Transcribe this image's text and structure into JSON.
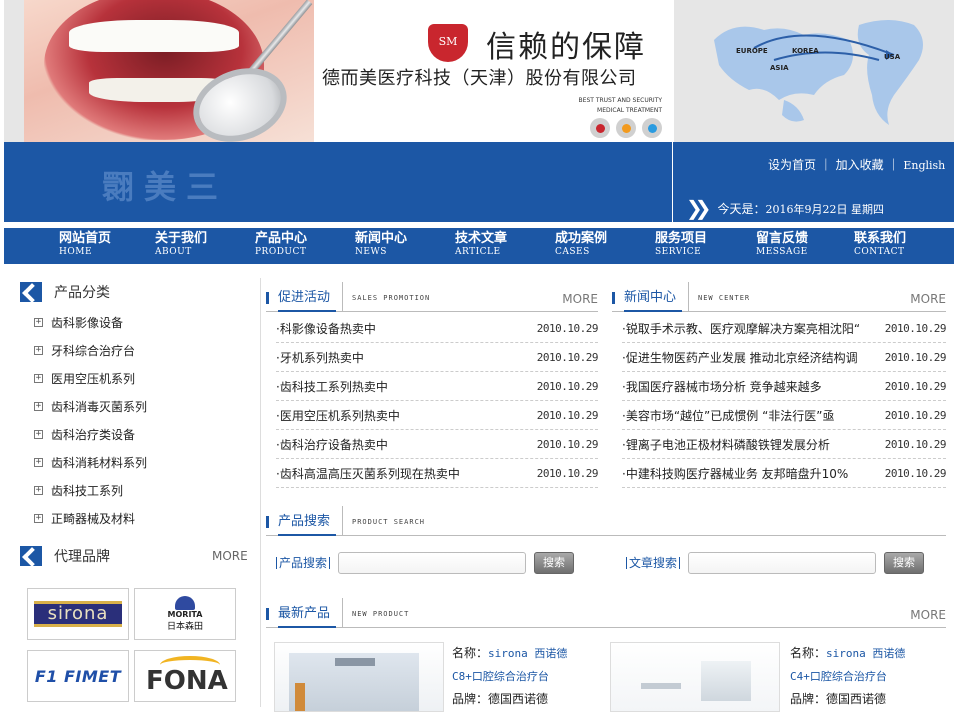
{
  "header": {
    "logo_text": "SM",
    "slogan": "信赖的保障",
    "company": "德而美医疗科技（天津）股份有限公司",
    "tagline_1": "BEST TRUST AND SECURITY",
    "tagline_2": "MEDICAL TREATMENT",
    "map_labels": [
      "EUROPE",
      "KOREA",
      "ASIA",
      "USA"
    ],
    "dot_colors": [
      "#c9262e",
      "#f29a1e",
      "#2a9be0"
    ],
    "band_brand": "翾美三",
    "links": [
      "设为首页",
      "加入收藏",
      "English"
    ],
    "date_prefix": "今天是：",
    "date_text": "2016年9月22日 星期四"
  },
  "nav": [
    {
      "cn": "网站首页",
      "en": "HOME"
    },
    {
      "cn": "关于我们",
      "en": "ABOUT"
    },
    {
      "cn": "产品中心",
      "en": "PRODUCT"
    },
    {
      "cn": "新闻中心",
      "en": "NEWS"
    },
    {
      "cn": "技术文章",
      "en": "ARTICLE"
    },
    {
      "cn": "成功案例",
      "en": "CASES"
    },
    {
      "cn": "服务项目",
      "en": "SERVICE"
    },
    {
      "cn": "留言反馈",
      "en": "MESSAGE"
    },
    {
      "cn": "联系我们",
      "en": "CONTACT"
    }
  ],
  "sidebar": {
    "categories_title": "产品分类",
    "categories": [
      "齿科影像设备",
      "牙科综合治疗台",
      "医用空压机系列",
      "齿科消毒灭菌系列",
      "齿科治疗类设备",
      "齿科消耗材料系列",
      "齿科技工系列",
      "正畸器械及材料"
    ],
    "brands_title": "代理品牌",
    "brands_more": "MORE",
    "brands": [
      "sirona",
      "MORITA",
      "日本森田",
      "F1 FIMET",
      "FONA"
    ]
  },
  "promo": {
    "title": "促进活动",
    "en": "SALES PROMOTION",
    "more": "MORE",
    "items": [
      {
        "title": "·科影像设备热卖中",
        "date": "2010.10.29"
      },
      {
        "title": "·牙机系列热卖中",
        "date": "2010.10.29"
      },
      {
        "title": "·齿科技工系列热卖中",
        "date": "2010.10.29"
      },
      {
        "title": "·医用空压机系列热卖中",
        "date": "2010.10.29"
      },
      {
        "title": "·齿科治疗设备热卖中",
        "date": "2010.10.29"
      },
      {
        "title": "·齿科高温高压灭菌系列现在热卖中",
        "date": "2010.10.29"
      }
    ]
  },
  "news": {
    "title": "新闻中心",
    "en": "NEW CENTER",
    "more": "MORE",
    "items": [
      {
        "title": "·锐取手术示教、医疗观摩解决方案亮相沈阳“",
        "date": "2010.10.29"
      },
      {
        "title": "·促进生物医药产业发展 推动北京经济结构调",
        "date": "2010.10.29"
      },
      {
        "title": "·我国医疗器械市场分析 竞争越来越多",
        "date": "2010.10.29"
      },
      {
        "title": "·美容市场“越位”已成惯例 “非法行医”亟",
        "date": "2010.10.29"
      },
      {
        "title": "·锂离子电池正极材料磷酸铁锂发展分析",
        "date": "2010.10.29"
      },
      {
        "title": "·中建科技购医疗器械业务 友邦暗盘升10%",
        "date": "2010.10.29"
      }
    ]
  },
  "search": {
    "title": "产品搜索",
    "en": "PRODUCT SEARCH",
    "product_label": "产品搜索",
    "article_label": "文章搜索",
    "button": "搜索"
  },
  "new_products": {
    "title": "最新产品",
    "en": "NEW PRODUCT",
    "more": "MORE",
    "name_label": "名称：",
    "brand_label": "品牌：",
    "items": [
      {
        "name": "sirona 西诺德 C8+口腔综合治疗台",
        "brand": "德国西诺德"
      },
      {
        "name": "sirona 西诺德 C4+口腔综合治疗台",
        "brand": "德国西诺德"
      }
    ]
  },
  "colors": {
    "primary": "#1c57a5"
  }
}
